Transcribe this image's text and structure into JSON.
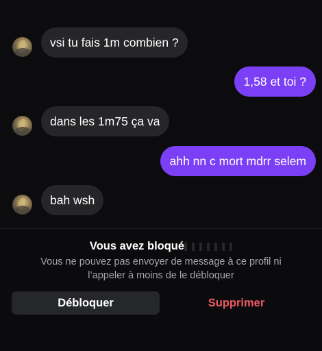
{
  "conversation": {
    "messages": [
      {
        "direction": "incoming",
        "text": "vsi tu fais 1m combien ?"
      },
      {
        "direction": "outgoing",
        "text": "1,58 et toi ?"
      },
      {
        "direction": "incoming",
        "text": "dans les 1m75 ça va"
      },
      {
        "direction": "outgoing",
        "text": "ahh nn c mort mdrr selem"
      },
      {
        "direction": "incoming",
        "text": "bah wsh"
      }
    ]
  },
  "blocked_notice": {
    "title": "Vous avez bloqué",
    "description": "Vous ne pouvez pas envoyer de message à ce profil ni l’appeler à moins de le débloquer",
    "unblock_label": "Débloquer",
    "delete_label": "Supprimer"
  },
  "colors": {
    "background": "#0c0c0e",
    "incoming_bubble": "#262629",
    "outgoing_bubble": "#7b3ff5",
    "delete_text": "#f25a66"
  }
}
